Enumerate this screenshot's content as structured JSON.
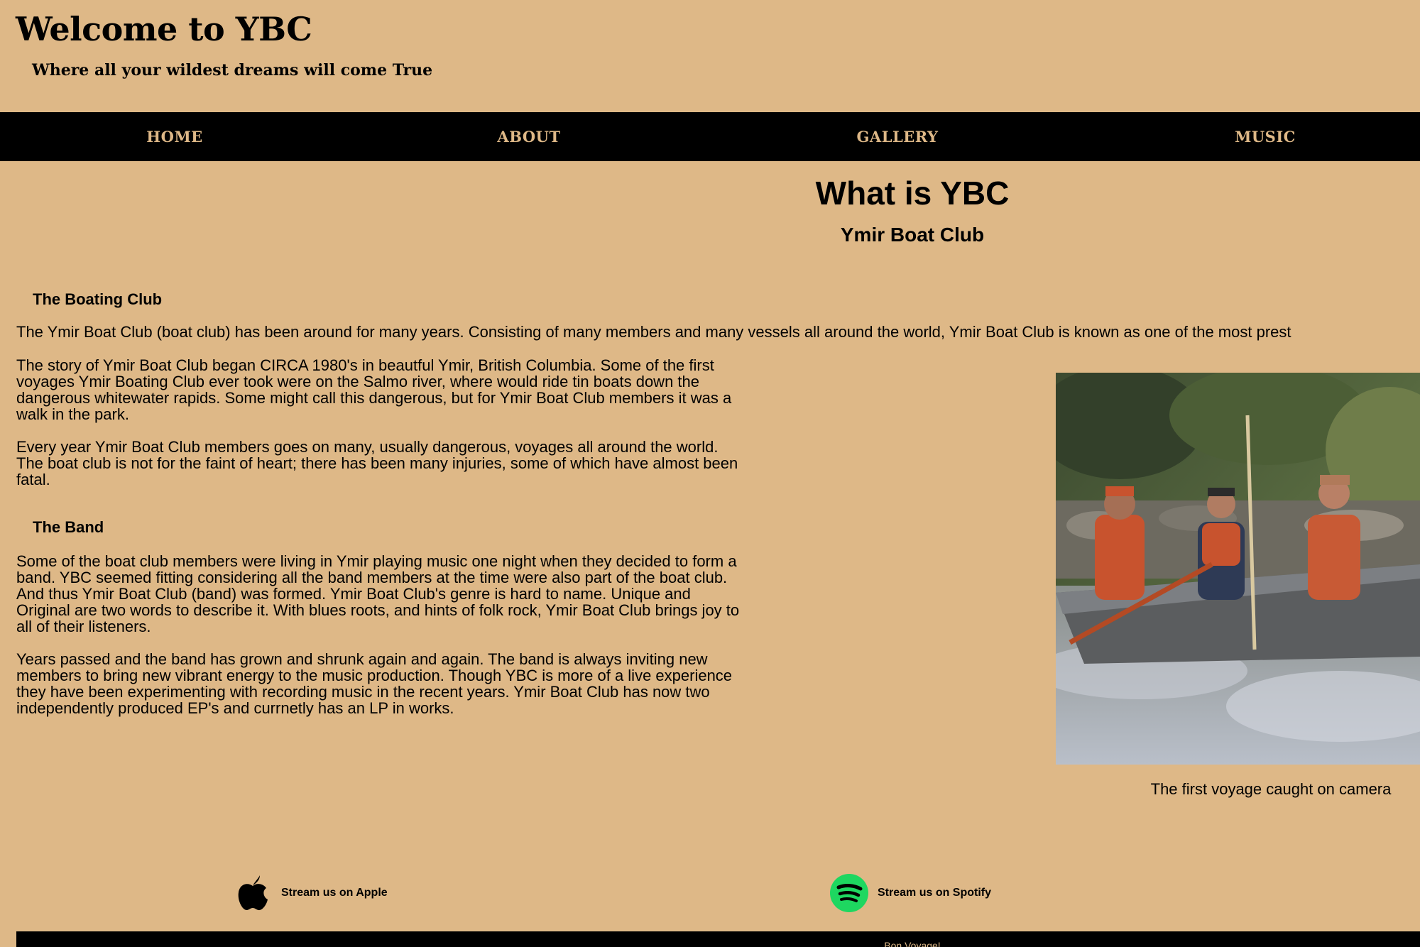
{
  "header": {
    "title": "Welcome to YBC",
    "tagline": "Where all your wildest dreams will come True"
  },
  "nav": {
    "items": [
      {
        "label": "HOME"
      },
      {
        "label": "ABOUT"
      },
      {
        "label": "GALLERY"
      },
      {
        "label": "MUSIC"
      }
    ]
  },
  "main": {
    "heading": "What is YBC",
    "subheading": "Ymir Boat Club",
    "sections": [
      {
        "heading": "The Boating Club",
        "paragraphs": [
          "The Ymir Boat Club (boat club) has been around for many years. Consisting of many members and many vessels all around the world, Ymir Boat Club is known as one of the most prest",
          "The story of Ymir Boat Club began CIRCA 1980's in beautful Ymir, British Columbia. Some of the first voyages Ymir Boating Club ever took were on the Salmo river, where would ride tin boats down the dangerous whitewater rapids. Some might call this dangerous, but for Ymir Boat Club members it was a walk in the park.",
          "Every year Ymir Boat Club members goes on many, usually dangerous, voyages all around the world. The boat club is not for the faint of heart; there has been many injuries, some of which have almost been fatal."
        ]
      },
      {
        "heading": "The Band",
        "paragraphs": [
          "Some of the boat club members were living in Ymir playing music one night when they decided to form a band. YBC seemed fitting considering all the band members at the time were also part of the boat club. And thus Ymir Boat Club (band) was formed. Ymir Boat Club's genre is hard to name. Unique and Original are two words to describe it. With blues roots, and hints of folk rock, Ymir Boat Club brings joy to all of their listeners.",
          "Years passed and the band has grown and shrunk again and again. The band is always inviting new members to bring new vibrant energy to the music production. Though YBC is more of a live experience they have been experimenting with recording music in the recent years. Ymir Boat Club has now two independently produced EP's and currnetly has an LP in works."
        ]
      }
    ],
    "photo": {
      "caption": "The first voyage caught on camera"
    }
  },
  "stream_links": [
    {
      "label": "Stream us on Apple",
      "icon": "apple-icon"
    },
    {
      "label": "Stream us on Spotify",
      "icon": "spotify-icon",
      "color": "#1ed760"
    }
  ],
  "footer": {
    "text": "Bon Voyage!"
  },
  "colors": {
    "background": "#deb887",
    "nav_background": "#000000",
    "nav_text": "#deb887"
  }
}
